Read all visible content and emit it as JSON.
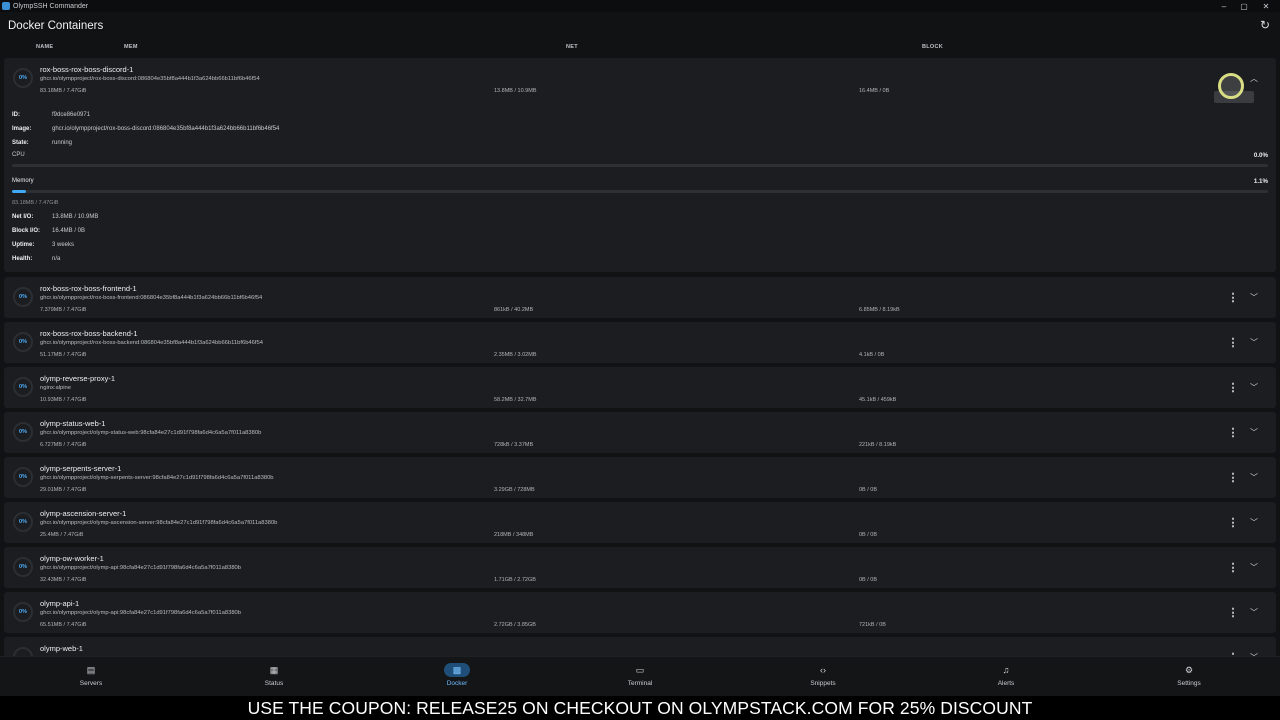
{
  "window": {
    "title": "OlympSSH Commander"
  },
  "header": {
    "title": "Docker Containers"
  },
  "columns": {
    "name": "NAME",
    "mem": "MEM",
    "net": "NET",
    "block": "BLOCK"
  },
  "expanded": {
    "name": "rox-boss-rox-boss-discord-1",
    "image": "ghcr.io/olympproject/rox-boss-discord:086804e35bf8a444b1f3a624bb66b11bf6b46f54",
    "mem": "83.18MB / 7.47GiB",
    "net": "13.8MB / 10.9MB",
    "block": "16.4MB / 0B",
    "ring": "0%",
    "details": {
      "id_label": "ID:",
      "id": "f9dce86e0971",
      "image_label": "Image:",
      "image": "ghcr.io/olympproject/rox-boss-discord:086804e35bf8a444b1f3a624bb66b11bf6b46f54",
      "state_label": "State:",
      "state": "running",
      "cpu_label": "CPU",
      "cpu_pct": "0.0%",
      "cpu_fraction": 0.0,
      "memory_label": "Memory",
      "memory_pct": "1.1%",
      "memory_fraction": 0.011,
      "memory_sub": "83.18MB / 7.47GiB",
      "netio_label": "Net I/O:",
      "netio": "13.8MB / 10.9MB",
      "blockio_label": "Block I/O:",
      "blockio": "16.4MB / 0B",
      "uptime_label": "Uptime:",
      "uptime": "3 weeks",
      "health_label": "Health:",
      "health": "n/a"
    }
  },
  "containers": [
    {
      "name": "rox-boss-rox-boss-frontend-1",
      "image": "ghcr.io/olympproject/rox-boss-frontend:086804e35bf8a444b1f3a624bb66b11bf6b46f54",
      "mem": "7.379MB / 7.47GiB",
      "net": "861kB / 40.2MB",
      "block": "6.85MB / 8.19kB",
      "ring": "0%"
    },
    {
      "name": "rox-boss-rox-boss-backend-1",
      "image": "ghcr.io/olympproject/rox-boss-backend:086804e35bf8a444b1f3a624bb66b11bf6b46f54",
      "mem": "51.17MB / 7.47GiB",
      "net": "2.35MB / 3.02MB",
      "block": "4.1kB / 0B",
      "ring": "0%"
    },
    {
      "name": "olymp-reverse-proxy-1",
      "image": "nginx:alpine",
      "mem": "10.93MB / 7.47GiB",
      "net": "58.2MB / 32.7MB",
      "block": "45.1kB / 459kB",
      "ring": "0%"
    },
    {
      "name": "olymp-status-web-1",
      "image": "ghcr.io/olympproject/olymp-status-web:98cfa84e27c1d91f798fa6d4c6a5a7f011a8380b",
      "mem": "6.727MB / 7.47GiB",
      "net": "728kB / 3.37MB",
      "block": "221kB / 8.19kB",
      "ring": "0%"
    },
    {
      "name": "olymp-serpents-server-1",
      "image": "ghcr.io/olympproject/olymp-serpents-server:98cfa84e27c1d91f798fa6d4c6a5a7f011a8380b",
      "mem": "29.01MB / 7.47GiB",
      "net": "3.29GB / 728MB",
      "block": "0B / 0B",
      "ring": "0%"
    },
    {
      "name": "olymp-ascension-server-1",
      "image": "ghcr.io/olympproject/olymp-ascension-server:98cfa84e27c1d91f798fa6d4c6a5a7f011a8380b",
      "mem": "25.4MB / 7.47GiB",
      "net": "218MB / 348MB",
      "block": "0B / 0B",
      "ring": "0%"
    },
    {
      "name": "olymp-ow-worker-1",
      "image": "ghcr.io/olympproject/olymp-api:98cfa84e27c1d91f798fa6d4c6a5a7f011a8380b",
      "mem": "32.43MB / 7.47GiB",
      "net": "1.71GB / 2.72GB",
      "block": "0B / 0B",
      "ring": "0%"
    },
    {
      "name": "olymp-api-1",
      "image": "ghcr.io/olympproject/olymp-api:98cfa84e27c1d91f798fa6d4c6a5a7f011a8380b",
      "mem": "65.51MB / 7.47GiB",
      "net": "2.72GB / 3.85GB",
      "block": "721kB / 0B",
      "ring": "0%"
    },
    {
      "name": "olymp-web-1",
      "image": "",
      "mem": "",
      "net": "",
      "block": "",
      "ring": ""
    }
  ],
  "nav": [
    {
      "label": "Servers",
      "icon": "server-icon",
      "glyph": "▤"
    },
    {
      "label": "Status",
      "icon": "grid-icon",
      "glyph": "▦"
    },
    {
      "label": "Docker",
      "icon": "docker-icon",
      "glyph": "▩"
    },
    {
      "label": "Terminal",
      "icon": "terminal-icon",
      "glyph": "▭"
    },
    {
      "label": "Snippets",
      "icon": "code-icon",
      "glyph": "‹›"
    },
    {
      "label": "Alerts",
      "icon": "bell-icon",
      "glyph": "♫"
    },
    {
      "label": "Settings",
      "icon": "gear-icon",
      "glyph": "⚙"
    }
  ],
  "nav_active": "Docker",
  "promo": {
    "text": "USE THE COUPON: RELEASE25 ON CHECKOUT ON OLYMPSTACK.COM FOR 25% DISCOUNT"
  },
  "colors": {
    "accent": "#3fa9f5",
    "active_nav_bg": "#1f4f78",
    "card_bg": "#1b1d20",
    "page_bg": "#111214"
  }
}
